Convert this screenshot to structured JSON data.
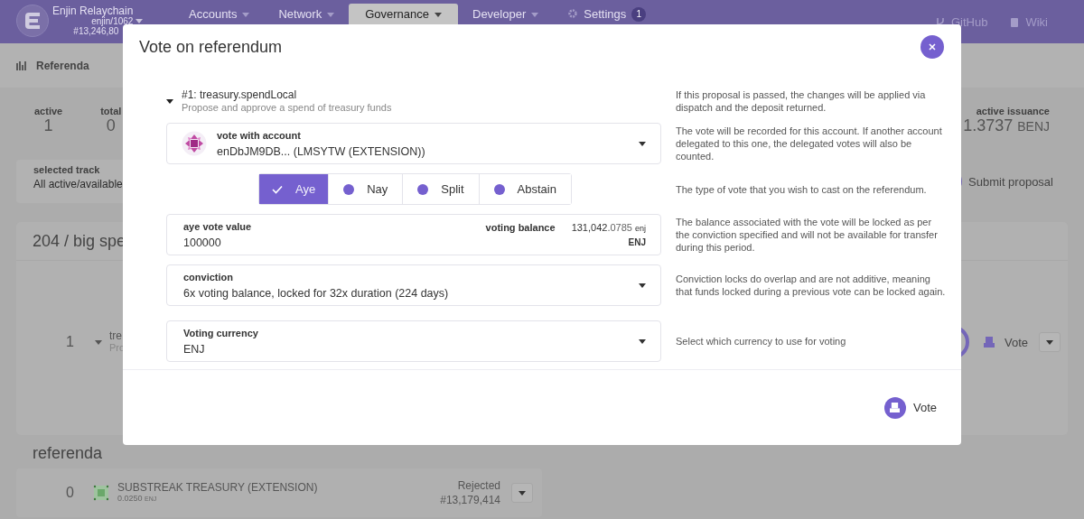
{
  "header": {
    "chain_name": "Enjin Relaychain",
    "account": "enjin/1062",
    "block": "#13,246,80",
    "nav": [
      {
        "label": "Accounts",
        "selected": false
      },
      {
        "label": "Network",
        "selected": false
      },
      {
        "label": "Governance",
        "selected": true
      },
      {
        "label": "Developer",
        "selected": false
      },
      {
        "label": "Settings",
        "selected": false,
        "badge": "1"
      }
    ],
    "links": [
      {
        "label": "GitHub",
        "kind": "branch"
      },
      {
        "label": "Wiki",
        "kind": "book"
      }
    ]
  },
  "subnav": {
    "label": "Referenda"
  },
  "stats": [
    {
      "label": "active",
      "value": "1"
    },
    {
      "label": "total",
      "value": "0"
    }
  ],
  "issuance": {
    "label": "active issuance",
    "value": "1.3737",
    "unit": "BENJ"
  },
  "submit_button": "Submit proposal",
  "track_select": {
    "label": "selected track",
    "value": "All active/available"
  },
  "track_card": {
    "title": "204 / big spe",
    "row": {
      "index": "1",
      "title": "tre",
      "subtitle": "Pro",
      "vote_button": "Vote"
    }
  },
  "referenda": {
    "title": "referenda",
    "rows": [
      {
        "index": "0",
        "name": "SUBSTREAK TREASURY (EXTENSION)",
        "balance": "0.0250",
        "unit": "ENJ",
        "status": "Rejected",
        "block": "#13,179,414"
      }
    ]
  },
  "modal": {
    "title": "Vote on referendum",
    "proposal": {
      "title": "#1: treasury.spendLocal",
      "description": "Propose and approve a spend of treasury funds",
      "expanded": true,
      "help": "If this proposal is passed, the changes will be applied via dispatch and the deposit returned."
    },
    "account": {
      "label": "vote with account",
      "value": "enDbJM9DB... (LMSYTW (EXTENSION))",
      "help": "The vote will be recorded for this account. If another account delegated to this one, the delegated votes will also be counted."
    },
    "vote_types": {
      "options": [
        {
          "label": "Aye",
          "selected": true
        },
        {
          "label": "Nay",
          "selected": false
        },
        {
          "label": "Split",
          "selected": false
        },
        {
          "label": "Abstain",
          "selected": false
        }
      ],
      "help": "The type of vote that you wish to cast on the referendum."
    },
    "amount": {
      "label": "aye vote value",
      "value": "100000",
      "balance_label": "voting balance",
      "balance_int": "131,042",
      "balance_frac": ".0785",
      "balance_unit": "enj",
      "unit": "ENJ",
      "help": "The balance associated with the vote will be locked as per the conviction specified and will not be available for transfer during this period."
    },
    "conviction": {
      "label": "conviction",
      "value": "6x voting balance, locked for 32x duration (224 days)",
      "help": "Conviction locks do overlap and are not additive, meaning that funds locked during a previous vote can be locked again."
    },
    "currency": {
      "label": "Voting currency",
      "value": "ENJ",
      "help": "Select which currency to use for voting"
    },
    "vote_button": "Vote"
  }
}
